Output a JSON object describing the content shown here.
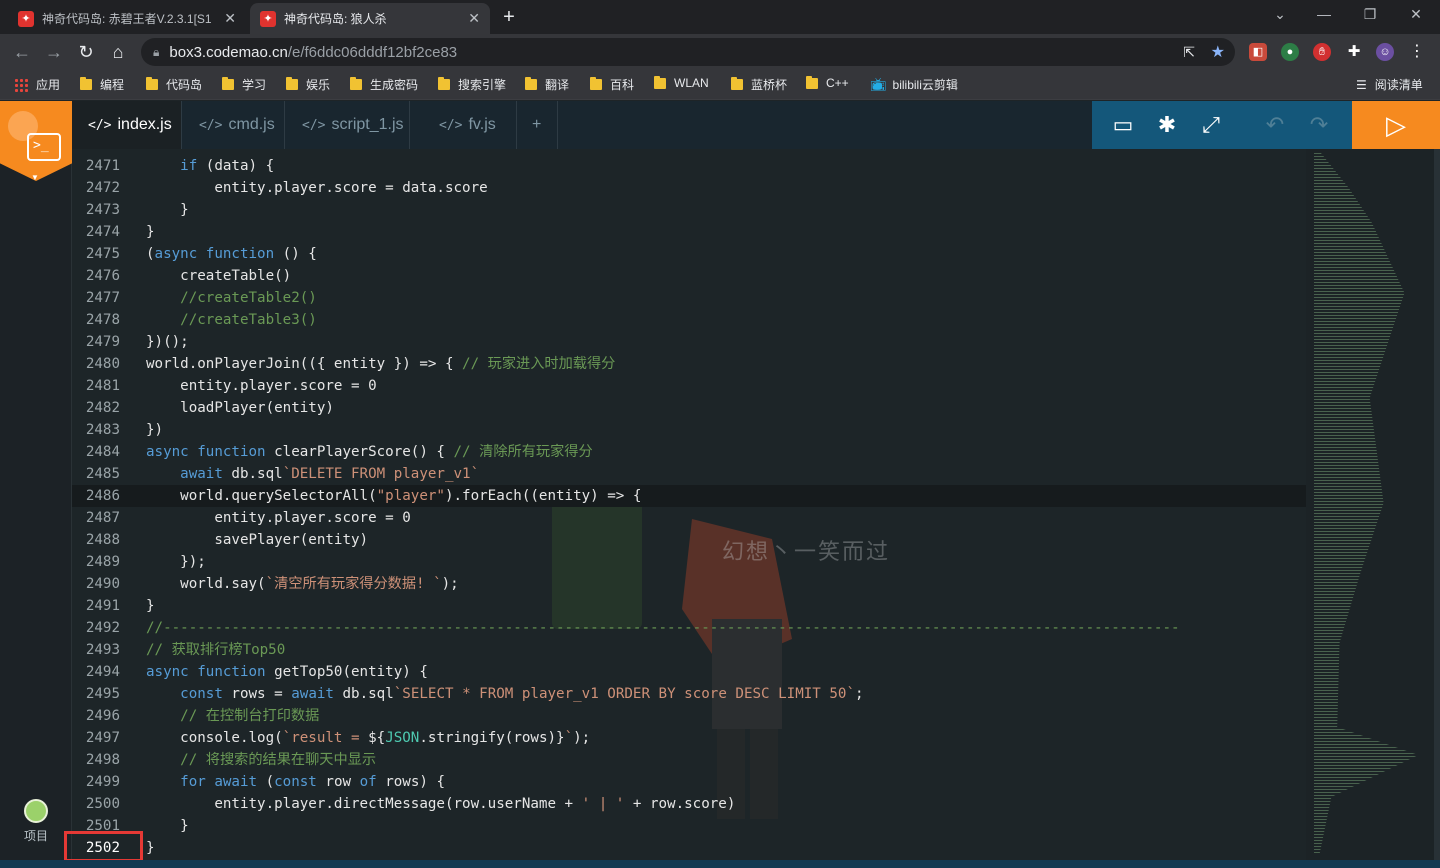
{
  "browser": {
    "tabs": [
      {
        "title": "神奇代码岛: 赤碧王者V.2.3.1[S1",
        "active": false
      },
      {
        "title": "神奇代码岛: 狼人杀",
        "active": true
      }
    ],
    "url_host": "box3.codemao.cn",
    "url_path": "/e/f6ddc06dddf12bf2ce83",
    "bookmarks": [
      "应用",
      "编程",
      "代码岛",
      "学习",
      "娱乐",
      "生成密码",
      "搜索引擎",
      "翻译",
      "百科",
      "WLAN",
      "蓝桥杯",
      "C++",
      "bilibili云剪辑"
    ],
    "reading_list": "阅读清单"
  },
  "editor": {
    "tabs": [
      "index.js",
      "cmd.js",
      "script_1.js",
      "fv.js"
    ],
    "add_tab": "+",
    "sidebar_project_label": "项目",
    "watermark": "幻想丶一笑而过",
    "lines": [
      {
        "n": "2471",
        "tokens": [
          [
            "",
            "    "
          ],
          [
            "kw",
            "if"
          ],
          [
            "",
            " (data) {"
          ]
        ]
      },
      {
        "n": "2472",
        "tokens": [
          [
            "",
            "        entity.player.score = data.score"
          ]
        ]
      },
      {
        "n": "2473",
        "tokens": [
          [
            "",
            "    }"
          ]
        ]
      },
      {
        "n": "2474",
        "tokens": [
          [
            "",
            "}"
          ]
        ]
      },
      {
        "n": "2475",
        "tokens": [
          [
            "",
            "("
          ],
          [
            "kw",
            "async function"
          ],
          [
            "",
            " () {"
          ]
        ]
      },
      {
        "n": "2476",
        "tokens": [
          [
            "",
            "    createTable()"
          ]
        ]
      },
      {
        "n": "2477",
        "tokens": [
          [
            "cm",
            "    //createTable2()"
          ]
        ]
      },
      {
        "n": "2478",
        "tokens": [
          [
            "cm",
            "    //createTable3()"
          ]
        ]
      },
      {
        "n": "2479",
        "tokens": [
          [
            "",
            "})();"
          ]
        ]
      },
      {
        "n": "2480",
        "tokens": [
          [
            "",
            "world.onPlayerJoin(({ entity }) => { "
          ],
          [
            "cm",
            "// 玩家进入时加载得分"
          ]
        ]
      },
      {
        "n": "2481",
        "tokens": [
          [
            "",
            "    entity.player.score = 0"
          ]
        ]
      },
      {
        "n": "2482",
        "tokens": [
          [
            "",
            "    loadPlayer(entity)"
          ]
        ]
      },
      {
        "n": "2483",
        "tokens": [
          [
            "",
            "})"
          ]
        ]
      },
      {
        "n": "2484",
        "tokens": [
          [
            "kw",
            "async function"
          ],
          [
            "",
            " clearPlayerScore() { "
          ],
          [
            "cm",
            "// 清除所有玩家得分"
          ]
        ]
      },
      {
        "n": "2485",
        "tokens": [
          [
            "",
            "    "
          ],
          [
            "kw",
            "await"
          ],
          [
            "",
            " db.sql"
          ],
          [
            "str",
            "`DELETE FROM player_v1`"
          ]
        ]
      },
      {
        "n": "2486",
        "tokens": [
          [
            "",
            "    world.querySelectorAll("
          ],
          [
            "str",
            "\"player\""
          ],
          [
            "",
            ").forEach((entity) => {"
          ]
        ]
      },
      {
        "n": "2487",
        "tokens": [
          [
            "",
            "        entity.player.score = 0"
          ]
        ]
      },
      {
        "n": "2488",
        "tokens": [
          [
            "",
            "        savePlayer(entity)"
          ]
        ]
      },
      {
        "n": "2489",
        "tokens": [
          [
            "",
            "    });"
          ]
        ]
      },
      {
        "n": "2490",
        "tokens": [
          [
            "",
            "    world.say("
          ],
          [
            "str",
            "`清空所有玩家得分数据! `"
          ],
          [
            "",
            ");"
          ]
        ]
      },
      {
        "n": "2491",
        "tokens": [
          [
            "",
            "}"
          ]
        ]
      },
      {
        "n": "2492",
        "tokens": [
          [
            "cm",
            "//-----------------------------------------------------------------------------------------------------------------------"
          ]
        ]
      },
      {
        "n": "2493",
        "tokens": [
          [
            "cm",
            "// 获取排行榜Top50"
          ]
        ]
      },
      {
        "n": "2494",
        "tokens": [
          [
            "kw",
            "async function"
          ],
          [
            "",
            " getTop50(entity) {"
          ]
        ]
      },
      {
        "n": "2495",
        "tokens": [
          [
            "",
            "    "
          ],
          [
            "kw",
            "const"
          ],
          [
            "",
            " rows = "
          ],
          [
            "kw",
            "await"
          ],
          [
            "",
            " db.sql"
          ],
          [
            "str",
            "`SELECT * FROM player_v1 ORDER BY score DESC LIMIT 50`"
          ],
          [
            "",
            ";"
          ]
        ]
      },
      {
        "n": "2496",
        "tokens": [
          [
            "cm",
            "    // 在控制台打印数据"
          ]
        ]
      },
      {
        "n": "2497",
        "tokens": [
          [
            "",
            "    console.log("
          ],
          [
            "str",
            "`result = "
          ],
          [
            "",
            "${"
          ],
          [
            "gl",
            "JSON"
          ],
          [
            "",
            ".stringify(rows)}"
          ],
          [
            "str",
            "`"
          ],
          [
            "",
            ");"
          ]
        ]
      },
      {
        "n": "2498",
        "tokens": [
          [
            "cm",
            "    // 将搜索的结果在聊天中显示"
          ]
        ]
      },
      {
        "n": "2499",
        "tokens": [
          [
            "",
            "    "
          ],
          [
            "kw",
            "for await"
          ],
          [
            "",
            " ("
          ],
          [
            "kw",
            "const"
          ],
          [
            "",
            " row "
          ],
          [
            "kw",
            "of"
          ],
          [
            "",
            " rows) {"
          ]
        ]
      },
      {
        "n": "2500",
        "tokens": [
          [
            "",
            "        entity.player.directMessage(row.userName + "
          ],
          [
            "str",
            "' | '"
          ],
          [
            "",
            " + row.score)"
          ]
        ]
      },
      {
        "n": "2501",
        "tokens": [
          [
            "",
            "    }"
          ]
        ]
      },
      {
        "n": "2502",
        "tokens": [
          [
            "",
            "}"
          ]
        ]
      }
    ]
  },
  "colors": {
    "accent": "#f68a1f",
    "action_bar": "#14577a",
    "highlight_marker": "#e53935"
  }
}
